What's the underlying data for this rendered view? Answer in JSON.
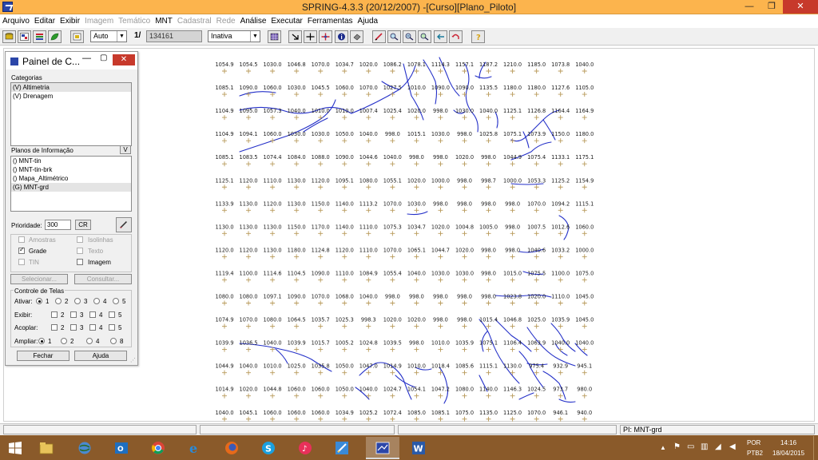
{
  "window": {
    "title": "SPRING-4.3.3 (20/12/2007) -[Curso][Plano_Piloto]",
    "controls": {
      "minimize": "—",
      "maximize": "❐",
      "close": "✕"
    }
  },
  "menu": [
    {
      "label": "Arquivo",
      "enabled": true
    },
    {
      "label": "Editar",
      "enabled": true
    },
    {
      "label": "Exibir",
      "enabled": true
    },
    {
      "label": "Imagem",
      "enabled": false
    },
    {
      "label": "Temático",
      "enabled": false
    },
    {
      "label": "MNT",
      "enabled": true
    },
    {
      "label": "Cadastral",
      "enabled": false
    },
    {
      "label": "Rede",
      "enabled": false
    },
    {
      "label": "Análise",
      "enabled": true
    },
    {
      "label": "Executar",
      "enabled": true
    },
    {
      "label": "Ferramentas",
      "enabled": true
    },
    {
      "label": "Ajuda",
      "enabled": true
    }
  ],
  "toolbar": {
    "zoom_mode": "Auto",
    "scale_prefix": "1/",
    "scale_value": "134161",
    "operation": "Inativa",
    "icons": [
      "database-icon",
      "catalog-icon",
      "layers-icon",
      "leaf-icon",
      "info-icon",
      "zoom-in-icon",
      "crosshair-icon",
      "pan-icon",
      "info-circle-icon",
      "eraser-icon",
      "pencil-icon",
      "zoom-icon",
      "zoom-out-icon",
      "zoom-refresh-icon",
      "back-icon",
      "undo-icon",
      "help-icon"
    ]
  },
  "panel": {
    "title": "Painel de C...",
    "categories_label": "Categorias",
    "categories": [
      "(V) Altimetria",
      "(V) Drenagem"
    ],
    "info_label": "Planos de Informação",
    "info_filter": "V",
    "info_planes": [
      "() MNT-tin",
      "() MNT-tin-brk",
      "() Mapa_Altimétrico",
      "(G) MNT-grd"
    ],
    "selected_plane_index": 3,
    "priority_label": "Prioridade:",
    "priority_value": "300",
    "cr_label": "CR",
    "options": [
      {
        "label": "Amostras",
        "checked": false,
        "enabled": false
      },
      {
        "label": "Isolinhas",
        "checked": false,
        "enabled": false
      },
      {
        "label": "Grade",
        "checked": true,
        "enabled": true
      },
      {
        "label": "Texto",
        "checked": false,
        "enabled": false
      },
      {
        "label": "TIN",
        "checked": false,
        "enabled": false
      },
      {
        "label": "Imagem",
        "checked": false,
        "enabled": true
      }
    ],
    "select_button": "Selecionar...",
    "consult_button": "Consultar...",
    "screens_label": "Controle de Telas",
    "activate_label": "Ativar:",
    "show_label": "Exibir:",
    "couple_label": "Acoplar:",
    "zoom_label": "Ampliar:",
    "screen_numbers": [
      "1",
      "2",
      "3",
      "4",
      "5"
    ],
    "zoom_options": [
      "1",
      "2",
      "4",
      "8"
    ],
    "close_button": "Fechar",
    "help_button": "Ajuda"
  },
  "grid": {
    "rows": [
      [
        "1054.9",
        "1054.5",
        "1030.0",
        "1046.8",
        "1070.0",
        "1034.7",
        "1020.0",
        "1086.2",
        "1078.1",
        "1114.3",
        "1157.1",
        "1187.2",
        "1210.0",
        "1185.0",
        "1073.8",
        "1040.0"
      ],
      [
        "1085.1",
        "1090.0",
        "1060.0",
        "1030.0",
        "1045.5",
        "1060.0",
        "1070.0",
        "1027.5",
        "1010.0",
        "1090.0",
        "1090.0",
        "1135.5",
        "1180.0",
        "1180.0",
        "1127.6",
        "1105.0"
      ],
      [
        "1104.9",
        "1095.0",
        "1057.3",
        "1040.0",
        "1010.0",
        "1010.0",
        "1007.4",
        "1025.4",
        "1020.0",
        "998.0",
        "1030.0",
        "1040.0",
        "1125.1",
        "1126.8",
        "1164.4",
        "1164.9"
      ],
      [
        "1104.9",
        "1094.1",
        "1060.0",
        "1030.0",
        "1030.0",
        "1050.0",
        "1040.0",
        "998.0",
        "1015.1",
        "1030.0",
        "998.0",
        "1025.8",
        "1075.1",
        "1073.9",
        "1150.0",
        "1180.0"
      ],
      [
        "1085.1",
        "1083.5",
        "1074.4",
        "1084.0",
        "1088.0",
        "1090.0",
        "1044.6",
        "1040.0",
        "998.0",
        "998.0",
        "1020.0",
        "998.0",
        "1044.9",
        "1075.4",
        "1133.1",
        "1175.1"
      ],
      [
        "1125.1",
        "1120.0",
        "1110.0",
        "1130.0",
        "1120.0",
        "1095.1",
        "1080.0",
        "1055.1",
        "1020.0",
        "1000.0",
        "998.0",
        "998.7",
        "1000.0",
        "1053.3",
        "1125.2",
        "1154.9"
      ],
      [
        "1133.9",
        "1130.0",
        "1120.0",
        "1130.0",
        "1150.0",
        "1140.0",
        "1113.2",
        "1070.0",
        "1030.0",
        "998.0",
        "998.0",
        "998.0",
        "998.0",
        "1070.0",
        "1094.2",
        "1115.1"
      ],
      [
        "1130.0",
        "1130.0",
        "1130.0",
        "1150.0",
        "1170.0",
        "1140.0",
        "1110.0",
        "1075.3",
        "1034.7",
        "1020.0",
        "1004.8",
        "1005.0",
        "998.0",
        "1007.5",
        "1012.6",
        "1060.0"
      ],
      [
        "1120.0",
        "1120.0",
        "1130.0",
        "1180.0",
        "1124.8",
        "1120.0",
        "1110.0",
        "1070.0",
        "1065.1",
        "1044.7",
        "1020.0",
        "998.0",
        "998.0",
        "1040.6",
        "1033.2",
        "1000.0"
      ],
      [
        "1119.4",
        "1100.0",
        "1114.6",
        "1104.5",
        "1090.0",
        "1110.0",
        "1084.9",
        "1055.4",
        "1040.0",
        "1030.0",
        "1030.0",
        "998.0",
        "1015.0",
        "1075.5",
        "1100.0",
        "1075.0"
      ],
      [
        "1080.0",
        "1080.0",
        "1097.1",
        "1090.0",
        "1070.0",
        "1068.0",
        "1040.0",
        "998.0",
        "998.0",
        "998.0",
        "998.0",
        "998.0",
        "1023.8",
        "1020.0",
        "1110.0",
        "1045.0"
      ],
      [
        "1074.9",
        "1070.0",
        "1080.0",
        "1064.5",
        "1035.7",
        "1025.3",
        "998.3",
        "1020.0",
        "1020.0",
        "998.0",
        "998.0",
        "1015.4",
        "1046.8",
        "1025.0",
        "1035.9",
        "1045.0"
      ],
      [
        "1039.9",
        "1036.5",
        "1040.0",
        "1039.9",
        "1015.7",
        "1005.2",
        "1024.8",
        "1039.5",
        "998.0",
        "1010.0",
        "1035.9",
        "1075.1",
        "1106.4",
        "1063.9",
        "1040.0",
        "1040.0"
      ],
      [
        "1044.9",
        "1040.0",
        "1010.0",
        "1025.0",
        "1035.8",
        "1050.0",
        "1047.0",
        "1014.9",
        "1010.0",
        "1018.4",
        "1085.6",
        "1115.1",
        "1130.0",
        "975.4",
        "932.9",
        "945.1"
      ],
      [
        "1014.9",
        "1020.0",
        "1044.8",
        "1060.0",
        "1060.0",
        "1050.0",
        "1040.0",
        "1024.7",
        "1054.1",
        "1047.2",
        "1080.0",
        "1140.0",
        "1146.3",
        "1024.5",
        "973.7",
        "980.0"
      ],
      [
        "1040.0",
        "1045.1",
        "1060.0",
        "1060.0",
        "1060.0",
        "1034.9",
        "1025.2",
        "1072.4",
        "1085.0",
        "1085.1",
        "1075.0",
        "1135.0",
        "1125.0",
        "1070.0",
        "946.1",
        "940.0"
      ]
    ]
  },
  "status": {
    "plane_label": "PI: MNT-grd"
  },
  "taskbar": {
    "apps": [
      "start-icon",
      "file-explorer-icon",
      "globe-icon",
      "outlook-icon",
      "chrome-icon",
      "internet-explorer-icon",
      "firefox-icon",
      "skype-icon",
      "itunes-icon",
      "notes-icon",
      "spring-icon",
      "word-icon"
    ],
    "language": "POR",
    "layout": "PTB2",
    "time": "14:16",
    "date": "18/04/2015"
  },
  "colors": {
    "titlebar": "#fcb44d",
    "drainage": "#2430c8",
    "grid_marker": "#b89a5a",
    "taskbar": "#8a5a2a"
  }
}
